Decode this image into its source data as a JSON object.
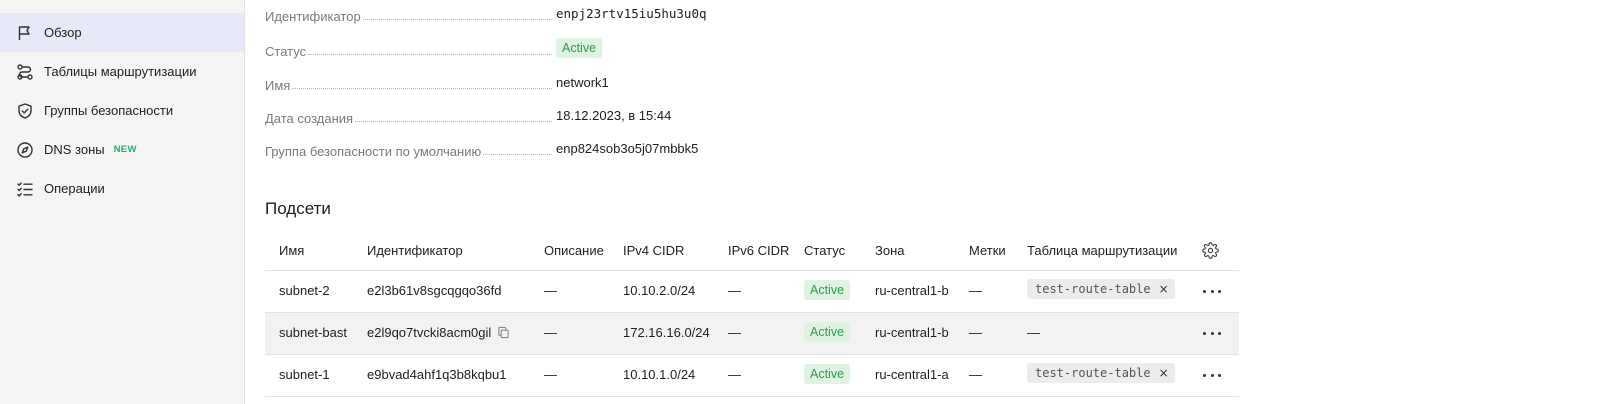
{
  "sidebar": {
    "items": [
      {
        "label": "Обзор",
        "icon": "flag-icon",
        "active": true
      },
      {
        "label": "Таблицы маршрутизации",
        "icon": "route-icon"
      },
      {
        "label": "Группы безопасности",
        "icon": "shield-icon"
      },
      {
        "label": "DNS зоны",
        "icon": "compass-icon",
        "badge": "NEW"
      },
      {
        "label": "Операции",
        "icon": "list-check-icon"
      }
    ]
  },
  "details": {
    "id_label": "Идентификатор",
    "id_value": "enpj23rtv15iu5hu3u0q",
    "status_label": "Статус",
    "status_value": "Active",
    "name_label": "Имя",
    "name_value": "network1",
    "created_label": "Дата создания",
    "created_value": "18.12.2023, в 15:44",
    "sg_label": "Группа безопасности по умолчанию",
    "sg_value": "enp824sob3o5j07mbbk5"
  },
  "subnets": {
    "title": "Подсети",
    "columns": [
      "Имя",
      "Идентификатор",
      "Описание",
      "IPv4 CIDR",
      "IPv6 CIDR",
      "Статус",
      "Зона",
      "Метки",
      "Таблица маршрутизации"
    ],
    "rows": [
      {
        "name": "subnet-2",
        "id": "e2l3b61v8sgcqgqo36fd",
        "description": "—",
        "ipv4": "10.10.2.0/24",
        "ipv6": "—",
        "status": "Active",
        "zone": "ru-central1-b",
        "labels": "—",
        "route_table": "test-route-table"
      },
      {
        "name": "subnet-bast",
        "id": "e2l9qo7tvcki8acm0gil",
        "description": "—",
        "ipv4": "172.16.16.0/24",
        "ipv6": "—",
        "status": "Active",
        "zone": "ru-central1-b",
        "labels": "—",
        "route_table": "—"
      },
      {
        "name": "subnet-1",
        "id": "e9bvad4ahf1q3b8kqbu1",
        "description": "—",
        "ipv4": "10.10.1.0/24",
        "ipv6": "—",
        "status": "Active",
        "zone": "ru-central1-a",
        "labels": "—",
        "route_table": "test-route-table"
      }
    ],
    "remove_symbol": "×"
  },
  "colors": {
    "accent_bg": "#e6e9f8",
    "status_green_bg": "#dff3e2",
    "status_green_text": "#2f9a4a",
    "badge_new": "#30aa6e"
  }
}
